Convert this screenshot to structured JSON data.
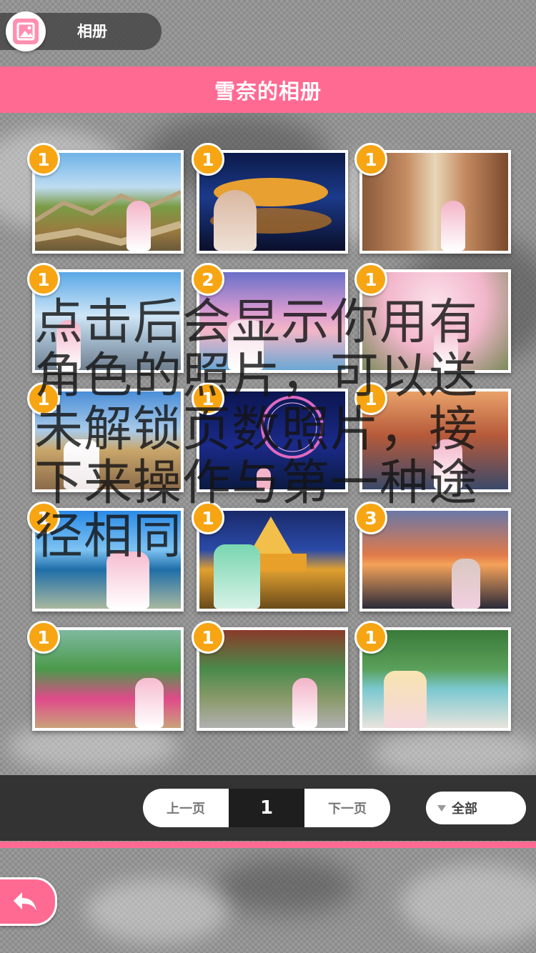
{
  "header": {
    "icon": "photo-album-icon",
    "label": "相册"
  },
  "title": "雪奈的相册",
  "photos": [
    {
      "count": "1",
      "scene": "great-wall"
    },
    {
      "count": "1",
      "scene": "birds-nest-night"
    },
    {
      "count": "1",
      "scene": "cafe-street"
    },
    {
      "count": "1",
      "scene": "city-plaza"
    },
    {
      "count": "2",
      "scene": "pink-sky-lake"
    },
    {
      "count": "1",
      "scene": "cherry-blossom"
    },
    {
      "count": "1",
      "scene": "grand-place"
    },
    {
      "count": "1",
      "scene": "ferris-wheel-night"
    },
    {
      "count": "1",
      "scene": "bridge-sunset"
    },
    {
      "count": "1",
      "scene": "seaside-path"
    },
    {
      "count": "1",
      "scene": "golden-pagoda"
    },
    {
      "count": "3",
      "scene": "ocean-sunset"
    },
    {
      "count": "1",
      "scene": "flower-field"
    },
    {
      "count": "1",
      "scene": "corridor"
    },
    {
      "count": "1",
      "scene": "terraced-pools"
    }
  ],
  "overlay_text": "点击后会显示你用有角色的照片，可以送未解锁页数照片，接下来操作与第一种途径相同",
  "pager": {
    "prev_label": "上一页",
    "page": "1",
    "next_label": "下一页"
  },
  "filter": {
    "selected": "全部"
  },
  "back": {
    "icon": "back-arrow-icon"
  },
  "colors": {
    "accent": "#ff6a93",
    "badge": "#f7a512"
  }
}
